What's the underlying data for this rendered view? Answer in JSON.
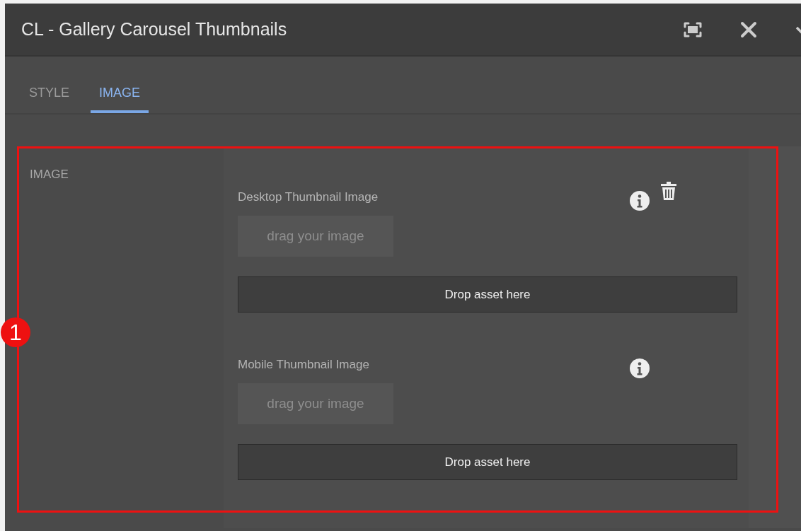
{
  "window": {
    "title": "CL - Gallery Carousel Thumbnails"
  },
  "tabs": [
    {
      "label": "STYLE",
      "selected": false
    },
    {
      "label": "IMAGE",
      "selected": true
    }
  ],
  "section": {
    "label": "IMAGE",
    "fields": [
      {
        "label": "Desktop Thumbnail Image",
        "placeholder": "drag your image",
        "drop_label": "Drop asset here",
        "has_delete": true
      },
      {
        "label": "Mobile Thumbnail Image",
        "placeholder": "drag your image",
        "drop_label": "Drop asset here",
        "has_delete": false
      }
    ]
  },
  "annotation": {
    "number": "1"
  }
}
